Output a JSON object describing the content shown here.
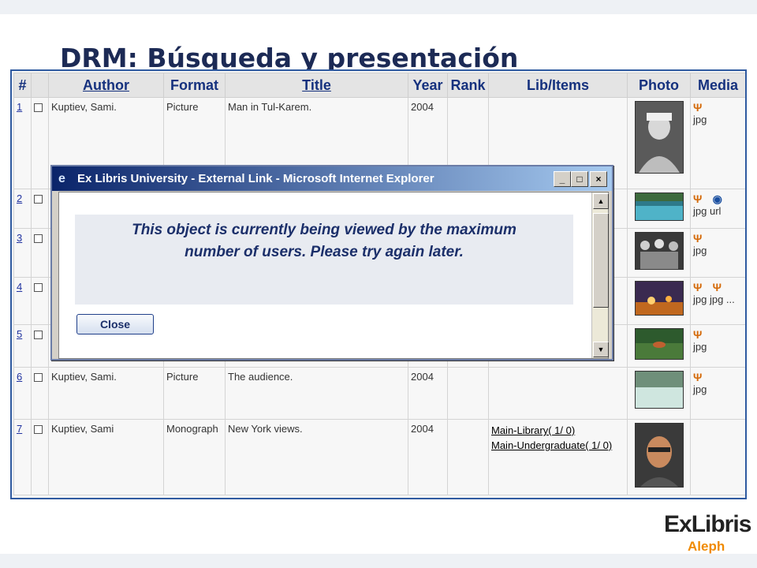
{
  "slide": {
    "title": "DRM: Búsqueda y presentación"
  },
  "table": {
    "headers": {
      "num": "#",
      "author": "Author",
      "format": "Format",
      "title": "Title",
      "year": "Year",
      "rank": "Rank",
      "lib_items": "Lib/Items",
      "photo": "Photo",
      "media": "Media"
    },
    "rows": [
      {
        "num": "1",
        "author": "Kuptiev, Sami.",
        "format": "Picture",
        "title": "Man in Tul-Karem.",
        "year": "2004",
        "media": "jpg"
      },
      {
        "num": "2",
        "media": "jpg url"
      },
      {
        "num": "3",
        "media": "jpg"
      },
      {
        "num": "4",
        "media": "jpg jpg ..."
      },
      {
        "num": "5",
        "media": "jpg"
      },
      {
        "num": "6",
        "author": "Kuptiev, Sami.",
        "format": "Picture",
        "title": "The audience.",
        "year": "2004",
        "media": "jpg"
      },
      {
        "num": "7",
        "author": "Kuptiev, Sami",
        "format": "Monograph",
        "title": "New York views.",
        "year": "2004",
        "lib_items": [
          "Main-Library( 1/ 0)",
          "Main-Undergraduate( 1/ 0)"
        ]
      }
    ]
  },
  "dialog": {
    "title": "Ex Libris University - External Link - Microsoft Internet Explorer",
    "message_line1": "This object is currently being viewed by the maximum",
    "message_line2": "number of users. Please try again later.",
    "close_label": "Close",
    "controls": {
      "minimize": "_",
      "maximize": "□",
      "close": "×"
    },
    "scroll": {
      "up": "▲",
      "down": "▼"
    }
  },
  "logo": {
    "main": "ExLibris",
    "sub": "Aleph"
  },
  "icons": {
    "ie": "e",
    "media_pencils": "Ψ",
    "url": "◉"
  },
  "colors": {
    "title": "#1c2a55",
    "frame_border": "#2f5aa0",
    "header_text": "#15317e",
    "dialog_titlebar": "#0a246a",
    "logo_accent": "#f08a00"
  }
}
